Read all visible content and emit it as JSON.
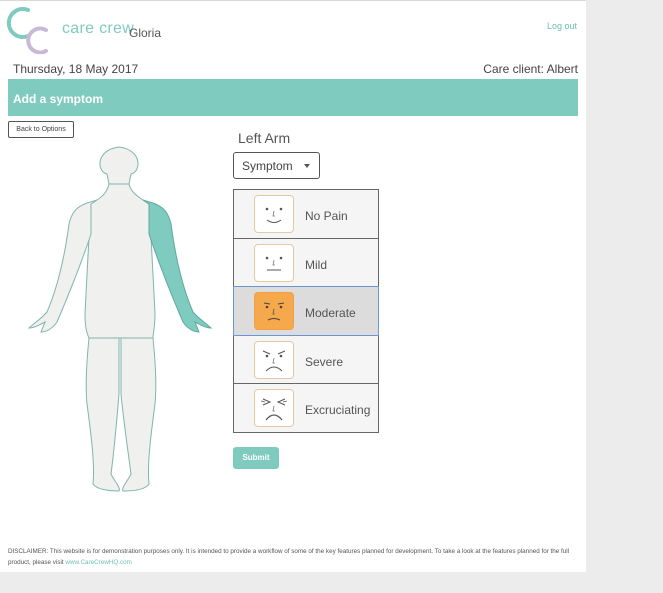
{
  "header": {
    "brand": "care crew",
    "user_name": "Gloria",
    "logout_label": "Log out",
    "date": "Thursday, 18 May 2017",
    "client": "Care client: Albert"
  },
  "banner": {
    "title": "Add a symptom"
  },
  "back_button": {
    "label": "Back to Options"
  },
  "body_map": {
    "selected_region": "left-arm",
    "highlight_color": "#7fcbbf"
  },
  "symptom_panel": {
    "region_title": "Left Arm",
    "select_label": "Symptom",
    "options": [
      {
        "label": "No Pain",
        "icon": "no-pain-face-icon",
        "selected": false
      },
      {
        "label": "Mild",
        "icon": "mild-face-icon",
        "selected": false
      },
      {
        "label": "Moderate",
        "icon": "moderate-face-icon",
        "selected": true
      },
      {
        "label": "Severe",
        "icon": "severe-face-icon",
        "selected": false
      },
      {
        "label": "Excruciating",
        "icon": "excruciating-face-icon",
        "selected": false
      }
    ],
    "submit_label": "Submit"
  },
  "footer": {
    "disclaimer_bold": "DISCLAIMER:",
    "disclaimer_text": "This website is for demonstration purposes only. It is intended to provide a workflow of some of the key features planned for development. To take a look at the features planned for the full product, please visit",
    "link_text": "www.CareCrewHQ.com"
  },
  "colors": {
    "accent": "#7fcbbf",
    "logo_secondary": "#c8b9d6",
    "moderate_face": "#f5a94c",
    "selected_border": "#6b96d6"
  }
}
